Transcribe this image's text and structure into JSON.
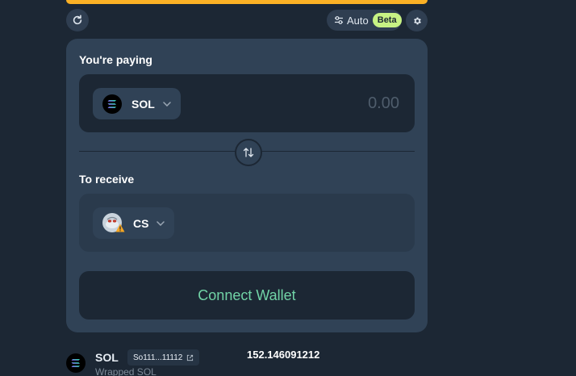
{
  "toolbar": {
    "refresh_icon": "refresh-icon",
    "auto_label": "Auto",
    "beta_badge": "Beta",
    "settings_icon": "gear-icon"
  },
  "paying": {
    "label": "You're paying",
    "token_symbol": "SOL",
    "amount_placeholder": "0.00"
  },
  "receiving": {
    "label": "To receive",
    "token_symbol": "CS"
  },
  "connect_wallet_label": "Connect Wallet",
  "token_info": {
    "symbol": "SOL",
    "address": "So111...11112",
    "name": "Wrapped SOL",
    "price": "152.146091212"
  },
  "colors": {
    "background": "#1c2734",
    "card": "#304256",
    "accent_bar": "#fbb125",
    "beta_badge": "#c7f284",
    "connect_text": "#71d3a6"
  }
}
